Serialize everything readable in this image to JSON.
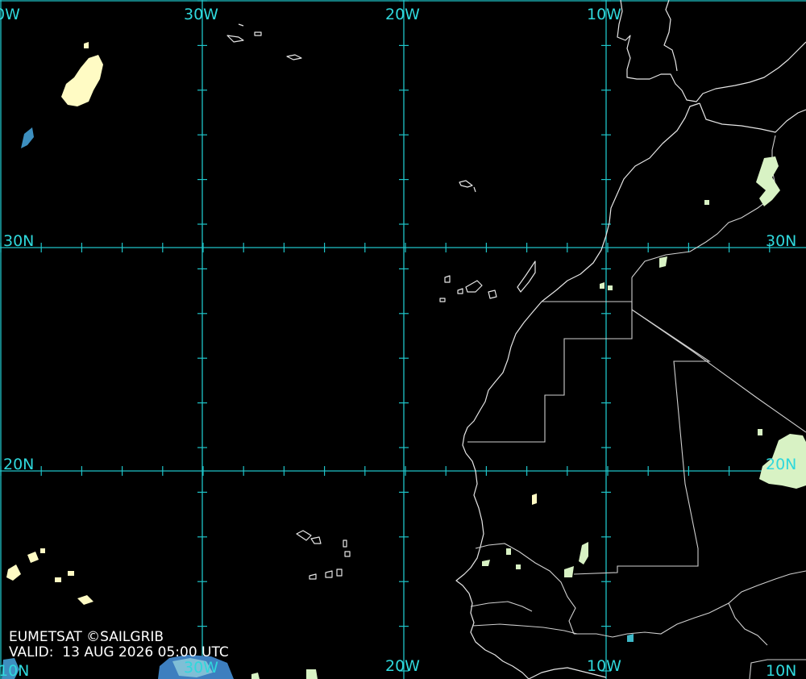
{
  "map": {
    "credit": "EUMETSAT ©SAILGRIB",
    "valid_prefix": "VALID:",
    "valid_time": "13 AUG 2026 05:00 UTC",
    "grid_labels": {
      "lon_top": [
        "0W",
        "30W",
        "20W",
        "10W"
      ],
      "lon_bottom": [
        "30W",
        "20W",
        "10W"
      ],
      "lat_right": [
        "30N",
        "20N",
        "10N"
      ],
      "lat_left": [
        "30N",
        "20N",
        "10N"
      ]
    },
    "colors": {
      "grid": "#1fc4c8",
      "coastline": "#e6e6e6",
      "cloud_light": "#fffbc4",
      "cloud_green": "#d8f2c4",
      "cloud_blue": "#3d7fbf",
      "background": "#000000"
    }
  }
}
